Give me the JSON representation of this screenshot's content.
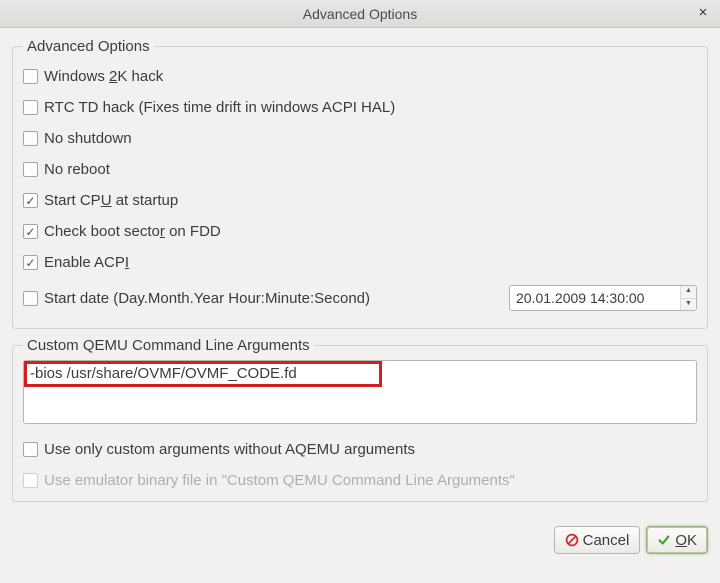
{
  "window": {
    "title": "Advanced Options"
  },
  "advanced": {
    "legend": "Advanced Options",
    "opts": [
      {
        "id": "win2k",
        "label_pre": "Windows ",
        "mn": "2",
        "label_post": "K hack",
        "checked": false
      },
      {
        "id": "rtctd",
        "label_pre": "RTC TD hack (Fixes time drift in windows ACPI HAL)",
        "mn": "",
        "label_post": "",
        "checked": false
      },
      {
        "id": "noshutdown",
        "label_pre": "No shutdown",
        "mn": "",
        "label_post": "",
        "checked": false
      },
      {
        "id": "noreboot",
        "label_pre": "No reboot",
        "mn": "",
        "label_post": "",
        "checked": false
      },
      {
        "id": "startcpu",
        "label_pre": "Start CP",
        "mn": "U",
        "label_post": " at startup",
        "checked": true
      },
      {
        "id": "checkboot",
        "label_pre": "Check boot secto",
        "mn": "r",
        "label_post": " on FDD",
        "checked": true
      },
      {
        "id": "enableacpi",
        "label_pre": "Enable ACP",
        "mn": "I",
        "label_post": "",
        "checked": true
      }
    ],
    "startdate": {
      "label": "Start date (Day.Month.Year Hour:Minute:Second)",
      "checked": false,
      "value": "20.01.2009 14:30:00"
    }
  },
  "cmdline": {
    "legend": "Custom QEMU Command Line Arguments",
    "text": "-bios /usr/share/OVMF/OVMF_CODE.fd",
    "use_only_custom": {
      "label": "Use only custom arguments without AQEMU arguments",
      "checked": false
    },
    "use_emu_binary": {
      "label": "Use emulator binary file in \"Custom QEMU Command Line Arguments\"",
      "checked": false,
      "disabled": true
    }
  },
  "buttons": {
    "cancel": "Cancel",
    "ok_pre": "",
    "ok_mn": "O",
    "ok_post": "K"
  }
}
